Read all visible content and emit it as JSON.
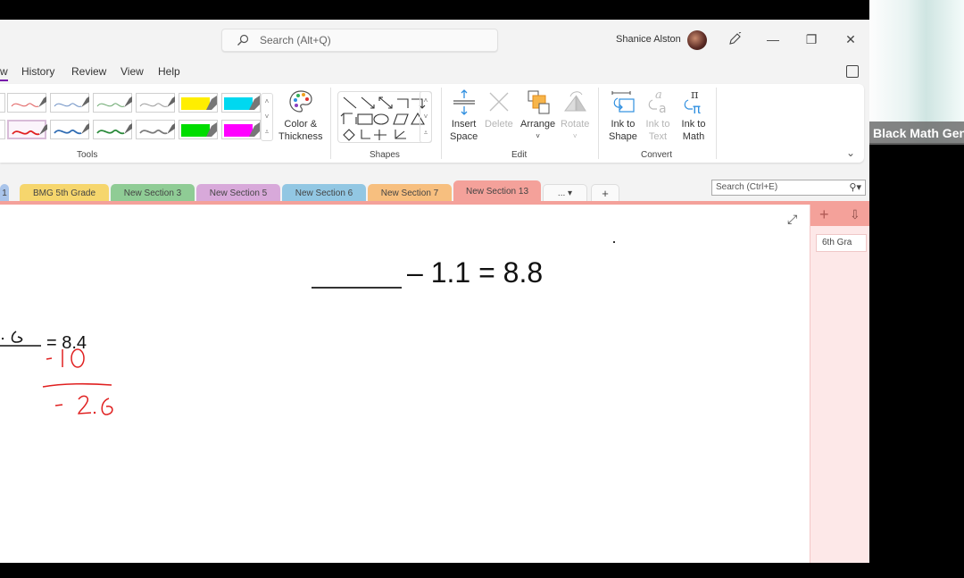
{
  "titlebar": {
    "search_placeholder": "Search (Alt+Q)",
    "user_name": "Shanice Alston",
    "minimize": "—",
    "restore": "❐",
    "close": "✕"
  },
  "menu": {
    "items": [
      {
        "label": "w",
        "active": true
      },
      {
        "label": "History"
      },
      {
        "label": "Review"
      },
      {
        "label": "View"
      },
      {
        "label": "Help"
      }
    ]
  },
  "ribbon": {
    "groups": {
      "tools": "Tools",
      "shapes": "Shapes",
      "edit": "Edit",
      "convert": "Convert"
    },
    "pens": {
      "row1": [
        "#e05b5b",
        "#6d90c4",
        "#6aa86e",
        "#9a9a9a",
        "#ffee00",
        "#00d8f0"
      ],
      "row2": [
        "#e02020",
        "#2f6cb3",
        "#2a8a3a",
        "#7a7a7a",
        "#00dd00",
        "#ff00ff"
      ]
    },
    "color_thickness": {
      "line1": "Color &",
      "line2": "Thickness"
    },
    "insert_space": {
      "line1": "Insert",
      "line2": "Space"
    },
    "delete": "Delete",
    "arrange": "Arrange",
    "rotate": "Rotate",
    "ink_to_shape": {
      "line1": "Ink to",
      "line2": "Shape"
    },
    "ink_to_text": {
      "line1": "Ink to",
      "line2": "Text"
    },
    "ink_to_math": {
      "line1": "Ink to",
      "line2": "Math"
    }
  },
  "sections": {
    "tabs": [
      {
        "label": "1",
        "color": "#a9c4ea"
      },
      {
        "label": "BMG 5th Grade",
        "color": "#f6d66d"
      },
      {
        "label": "New Section 3",
        "color": "#8fcc95"
      },
      {
        "label": "New Section 5",
        "color": "#d8a9da"
      },
      {
        "label": "New Section 6",
        "color": "#92c7e3"
      },
      {
        "label": "New Section 7",
        "color": "#f7bf7f"
      },
      {
        "label": "New Section 13",
        "color": "#f4a19a",
        "active": true
      }
    ],
    "more_label": "... ▾",
    "add_label": "+",
    "search_placeholder": "Search (Ctrl+E)"
  },
  "pages": {
    "add": "+",
    "sort": "⇩",
    "items": [
      "6th Gra"
    ]
  },
  "canvas": {
    "typed_equation": "– 1.1 = 8.8",
    "left_equation_fragment": "= 8.4",
    "ink_steps": [
      "- 10",
      "-2.6"
    ]
  },
  "video": {
    "participant_label": "Black Math Gen"
  }
}
